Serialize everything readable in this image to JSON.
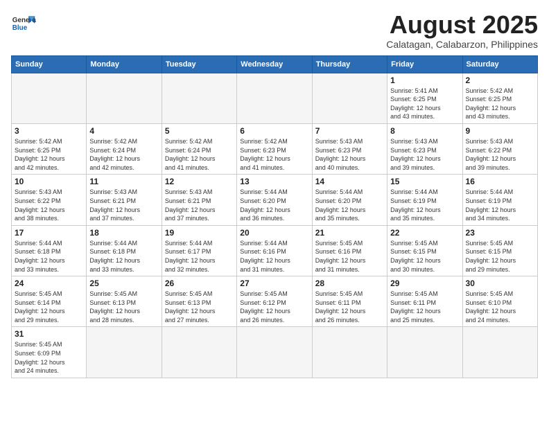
{
  "header": {
    "logo_line1": "General",
    "logo_line2": "Blue",
    "main_title": "August 2025",
    "subtitle": "Calatagan, Calabarzon, Philippines"
  },
  "weekdays": [
    "Sunday",
    "Monday",
    "Tuesday",
    "Wednesday",
    "Thursday",
    "Friday",
    "Saturday"
  ],
  "weeks": [
    [
      {
        "day": "",
        "info": ""
      },
      {
        "day": "",
        "info": ""
      },
      {
        "day": "",
        "info": ""
      },
      {
        "day": "",
        "info": ""
      },
      {
        "day": "",
        "info": ""
      },
      {
        "day": "1",
        "info": "Sunrise: 5:41 AM\nSunset: 6:25 PM\nDaylight: 12 hours\nand 43 minutes."
      },
      {
        "day": "2",
        "info": "Sunrise: 5:42 AM\nSunset: 6:25 PM\nDaylight: 12 hours\nand 43 minutes."
      }
    ],
    [
      {
        "day": "3",
        "info": "Sunrise: 5:42 AM\nSunset: 6:25 PM\nDaylight: 12 hours\nand 42 minutes."
      },
      {
        "day": "4",
        "info": "Sunrise: 5:42 AM\nSunset: 6:24 PM\nDaylight: 12 hours\nand 42 minutes."
      },
      {
        "day": "5",
        "info": "Sunrise: 5:42 AM\nSunset: 6:24 PM\nDaylight: 12 hours\nand 41 minutes."
      },
      {
        "day": "6",
        "info": "Sunrise: 5:42 AM\nSunset: 6:23 PM\nDaylight: 12 hours\nand 41 minutes."
      },
      {
        "day": "7",
        "info": "Sunrise: 5:43 AM\nSunset: 6:23 PM\nDaylight: 12 hours\nand 40 minutes."
      },
      {
        "day": "8",
        "info": "Sunrise: 5:43 AM\nSunset: 6:23 PM\nDaylight: 12 hours\nand 39 minutes."
      },
      {
        "day": "9",
        "info": "Sunrise: 5:43 AM\nSunset: 6:22 PM\nDaylight: 12 hours\nand 39 minutes."
      }
    ],
    [
      {
        "day": "10",
        "info": "Sunrise: 5:43 AM\nSunset: 6:22 PM\nDaylight: 12 hours\nand 38 minutes."
      },
      {
        "day": "11",
        "info": "Sunrise: 5:43 AM\nSunset: 6:21 PM\nDaylight: 12 hours\nand 37 minutes."
      },
      {
        "day": "12",
        "info": "Sunrise: 5:43 AM\nSunset: 6:21 PM\nDaylight: 12 hours\nand 37 minutes."
      },
      {
        "day": "13",
        "info": "Sunrise: 5:44 AM\nSunset: 6:20 PM\nDaylight: 12 hours\nand 36 minutes."
      },
      {
        "day": "14",
        "info": "Sunrise: 5:44 AM\nSunset: 6:20 PM\nDaylight: 12 hours\nand 35 minutes."
      },
      {
        "day": "15",
        "info": "Sunrise: 5:44 AM\nSunset: 6:19 PM\nDaylight: 12 hours\nand 35 minutes."
      },
      {
        "day": "16",
        "info": "Sunrise: 5:44 AM\nSunset: 6:19 PM\nDaylight: 12 hours\nand 34 minutes."
      }
    ],
    [
      {
        "day": "17",
        "info": "Sunrise: 5:44 AM\nSunset: 6:18 PM\nDaylight: 12 hours\nand 33 minutes."
      },
      {
        "day": "18",
        "info": "Sunrise: 5:44 AM\nSunset: 6:18 PM\nDaylight: 12 hours\nand 33 minutes."
      },
      {
        "day": "19",
        "info": "Sunrise: 5:44 AM\nSunset: 6:17 PM\nDaylight: 12 hours\nand 32 minutes."
      },
      {
        "day": "20",
        "info": "Sunrise: 5:44 AM\nSunset: 6:16 PM\nDaylight: 12 hours\nand 31 minutes."
      },
      {
        "day": "21",
        "info": "Sunrise: 5:45 AM\nSunset: 6:16 PM\nDaylight: 12 hours\nand 31 minutes."
      },
      {
        "day": "22",
        "info": "Sunrise: 5:45 AM\nSunset: 6:15 PM\nDaylight: 12 hours\nand 30 minutes."
      },
      {
        "day": "23",
        "info": "Sunrise: 5:45 AM\nSunset: 6:15 PM\nDaylight: 12 hours\nand 29 minutes."
      }
    ],
    [
      {
        "day": "24",
        "info": "Sunrise: 5:45 AM\nSunset: 6:14 PM\nDaylight: 12 hours\nand 29 minutes."
      },
      {
        "day": "25",
        "info": "Sunrise: 5:45 AM\nSunset: 6:13 PM\nDaylight: 12 hours\nand 28 minutes."
      },
      {
        "day": "26",
        "info": "Sunrise: 5:45 AM\nSunset: 6:13 PM\nDaylight: 12 hours\nand 27 minutes."
      },
      {
        "day": "27",
        "info": "Sunrise: 5:45 AM\nSunset: 6:12 PM\nDaylight: 12 hours\nand 26 minutes."
      },
      {
        "day": "28",
        "info": "Sunrise: 5:45 AM\nSunset: 6:11 PM\nDaylight: 12 hours\nand 26 minutes."
      },
      {
        "day": "29",
        "info": "Sunrise: 5:45 AM\nSunset: 6:11 PM\nDaylight: 12 hours\nand 25 minutes."
      },
      {
        "day": "30",
        "info": "Sunrise: 5:45 AM\nSunset: 6:10 PM\nDaylight: 12 hours\nand 24 minutes."
      }
    ],
    [
      {
        "day": "31",
        "info": "Sunrise: 5:45 AM\nSunset: 6:09 PM\nDaylight: 12 hours\nand 24 minutes."
      },
      {
        "day": "",
        "info": ""
      },
      {
        "day": "",
        "info": ""
      },
      {
        "day": "",
        "info": ""
      },
      {
        "day": "",
        "info": ""
      },
      {
        "day": "",
        "info": ""
      },
      {
        "day": "",
        "info": ""
      }
    ]
  ]
}
